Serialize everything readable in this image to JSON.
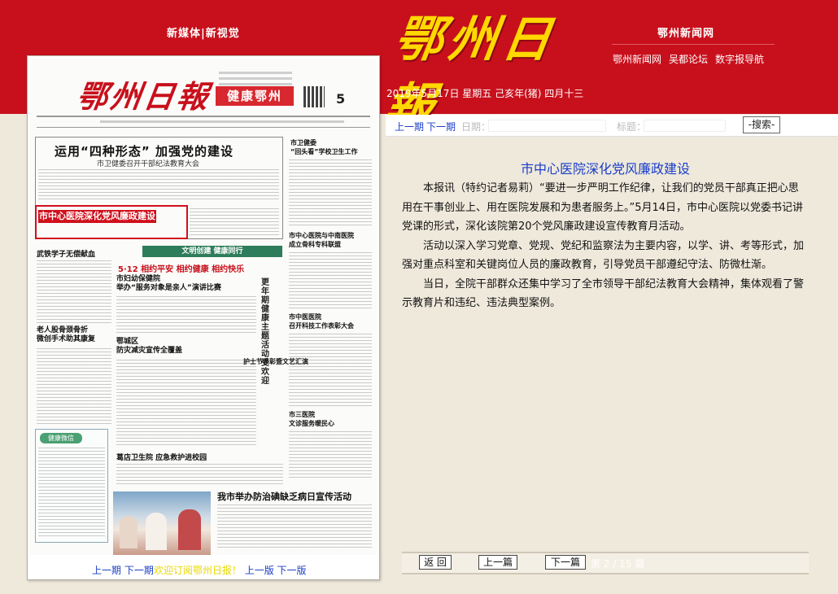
{
  "header": {
    "left_tagline": "新媒体|新视觉",
    "masthead": "鄂州日報",
    "date": "2019年5月17日 星期五 己亥年(猪) 四月十三",
    "site_name": "鄂州新闻网",
    "nav_links": [
      "鄂州新闻网",
      "吴都论坛",
      "数字报导航"
    ]
  },
  "paper": {
    "logo": "鄂州日報",
    "section_banner": "健康鄂州",
    "page_number": "5",
    "lead_headline": "运用“四种形态” 加强党的建设",
    "lead_subhead": "市卫健委召开干部纪法教育大会",
    "highlight_link": "市中心医院深化党风廉政建设",
    "right_col_1": "市卫健委\n“回头看”学校卫生工作",
    "right_col_2": "市中心医院与中南医院\n成立骨科专科联盟",
    "right_col_3": "市中医医院\n召开科技工作表彰大会",
    "right_col_4": "市三医院\n文诊服务暖民心",
    "green_banner": "文明创建  健康同行",
    "red_headline": "5·12 相约平安 相约健康 相约快乐",
    "vertical_title": "更年期健康主题活动受欢迎",
    "left_col_1": "武铁学子无偿献血",
    "left_col_2": "老人股骨颈骨折\n微创手术助其康复",
    "mid_col_1": "市妇幼保健院\n举办“服务对象是亲人”演讲比赛",
    "mid_col_2": "鄂城区\n防灾减灾宣传全覆盖",
    "mid_col_3": "葛店卫生院 应急救护进校园",
    "mid_col_4": "护士节表彰暨文艺汇演",
    "bottom_headline": "我市举办防治碘缺乏病日宣传活动",
    "green_box_label": "健康微信",
    "nav": {
      "prev_issue": "上一期",
      "next_issue": "下一期",
      "subscribe": "欢迎订阅鄂州日报！",
      "prev_page": "上一版",
      "next_page": "下一版"
    }
  },
  "toolbar": {
    "prev_issue": "上一期",
    "next_issue": "下一期",
    "date_label": "日期：",
    "date_value": "",
    "title_label": "标题：",
    "title_value": "",
    "search_button": "-搜索-"
  },
  "article": {
    "title": "市中心医院深化党风廉政建设",
    "paragraphs": [
      "本报讯（特约记者易莉）“要进一步严明工作纪律，让我们的党员干部真正把心思用在干事创业上、用在医院发展和为患者服务上。”5月14日，市中心医院以党委书记讲党课的形式，深化该院第20个党风廉政建设宣传教育月活动。",
      "活动以深入学习党章、党规、党纪和监察法为主要内容，以学、讲、考等形式，加强对重点科室和关键岗位人员的廉政教育，引导党员干部遵纪守法、防微杜渐。",
      "当日，全院干部群众还集中学习了全市领导干部纪法教育大会精神，集体观看了警示教育片和违纪、违法典型案例。"
    ]
  },
  "pagination": {
    "back": "返 回",
    "prev": "上一篇",
    "next": "下一篇",
    "count": "第 2 / 15 篇"
  }
}
